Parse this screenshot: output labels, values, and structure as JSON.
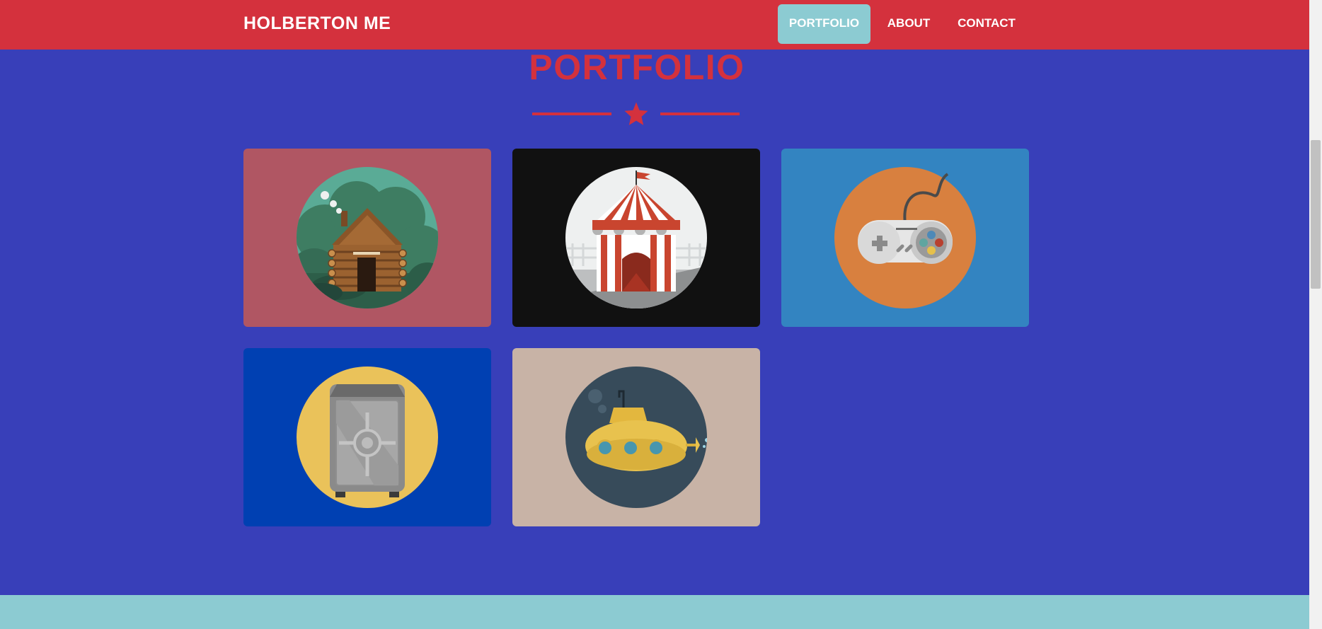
{
  "navbar": {
    "brand": "HOLBERTON ME",
    "links": [
      {
        "label": "PORTFOLIO",
        "active": true
      },
      {
        "label": "ABOUT",
        "active": false
      },
      {
        "label": "CONTACT",
        "active": false
      }
    ]
  },
  "portfolio": {
    "title": "PORTFOLIO",
    "divider_icon": "star-icon",
    "items": [
      {
        "name": "cabin",
        "icon": "cabin-icon",
        "bg": "#b05663"
      },
      {
        "name": "circus tent",
        "icon": "circus-tent-icon",
        "bg": "#111111"
      },
      {
        "name": "game controller",
        "icon": "game-controller-icon",
        "bg": "#3384c1"
      },
      {
        "name": "safe",
        "icon": "safe-icon",
        "bg": "#0040b2"
      },
      {
        "name": "submarine",
        "icon": "submarine-icon",
        "bg": "#c8b3a6"
      }
    ]
  },
  "colors": {
    "page_bg": "#383fb9",
    "accent_red": "#d4313d",
    "accent_teal": "#8ccbd2"
  }
}
